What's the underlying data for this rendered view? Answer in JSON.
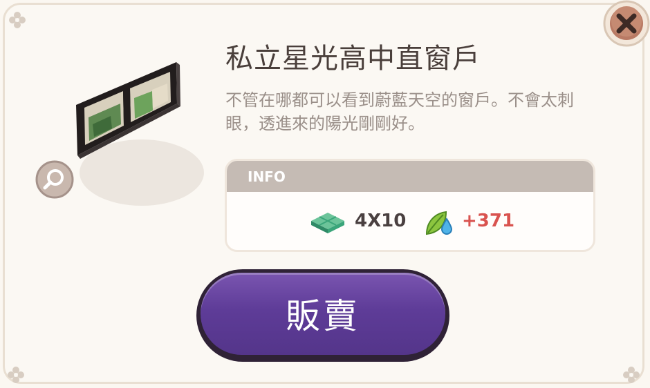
{
  "dialog": {
    "title": "私立星光高中直窗戶",
    "description": "不管在哪都可以看到蔚藍天空的窗戶。不會太刺眼，透進來的陽光剛剛好。",
    "close_icon": "close-icon",
    "zoom_icon": "magnifier-icon",
    "info": {
      "header": "INFO",
      "size_icon": "floor-tile-icon",
      "size": "4X10",
      "bonus_icon": "leaf-droplet-icon",
      "bonus": "+371"
    },
    "sell_button": "販賣"
  },
  "colors": {
    "accent_purple": "#5e3c98",
    "bonus_red": "#d9534f",
    "close_brown": "#b97a64"
  }
}
